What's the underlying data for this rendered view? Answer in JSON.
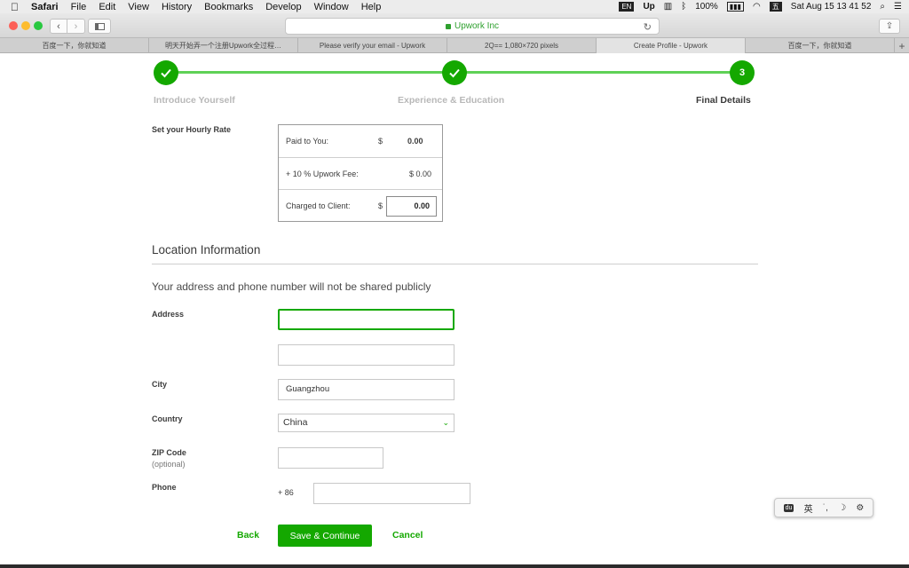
{
  "menubar": {
    "apple": "",
    "items": [
      "Safari",
      "File",
      "Edit",
      "View",
      "History",
      "Bookmarks",
      "Develop",
      "Window",
      "Help"
    ],
    "status": {
      "input_source": "EN",
      "upwork": "Up",
      "battery_percent": "100%",
      "battery_label": "",
      "wubi": "五",
      "datetime": "Sat Aug 15  13 41 52"
    }
  },
  "toolbar": {
    "back": "‹",
    "forward": "›",
    "url_text": "Upwork Inc",
    "reload": "↻",
    "share": "⇪"
  },
  "tabs": [
    {
      "label": "百度一下，你就知道",
      "active": false
    },
    {
      "label": "明天开始弄一个注册Upwork全过程…",
      "active": false
    },
    {
      "label": "Please verify your email - Upwork",
      "active": false
    },
    {
      "label": "2Q== 1,080×720 pixels",
      "active": false
    },
    {
      "label": "Create Profile - Upwork",
      "active": true
    },
    {
      "label": "百度一下，你就知道",
      "active": false
    }
  ],
  "tab_add": "+",
  "stepper": {
    "steps": [
      {
        "label": "Introduce Yourself",
        "state": "done"
      },
      {
        "label": "Experience & Education",
        "state": "done"
      },
      {
        "label": "Final Details",
        "state": "current",
        "number": "3"
      }
    ]
  },
  "rate": {
    "label": "Set your Hourly Rate",
    "paid_label": "Paid to You:",
    "paid_currency": "$",
    "paid_value": "0.00",
    "fee_label": "+ 10 % Upwork Fee:",
    "fee_value": "$ 0.00",
    "charged_label": "Charged to Client:",
    "charged_currency": "$",
    "charged_value": "0.00"
  },
  "location": {
    "title": "Location Information",
    "note": "Your address and phone number will not be shared publicly",
    "address_label": "Address",
    "address_line1": "",
    "address_line2": "",
    "city_label": "City",
    "city_value": "Guangzhou",
    "country_label": "Country",
    "country_value": "China",
    "zip_label": "ZIP Code",
    "zip_optional": "(optional)",
    "zip_value": "",
    "phone_label": "Phone",
    "phone_prefix": "+  86",
    "phone_value": ""
  },
  "actions": {
    "back": "Back",
    "save": "Save & Continue",
    "cancel": "Cancel"
  },
  "ime": {
    "logo": "du",
    "lang": "英",
    "punct": "˙,",
    "moon": "☽",
    "gear": "⚙"
  },
  "colors": {
    "brand_green": "#14a800",
    "step_line": "#5fd156"
  }
}
